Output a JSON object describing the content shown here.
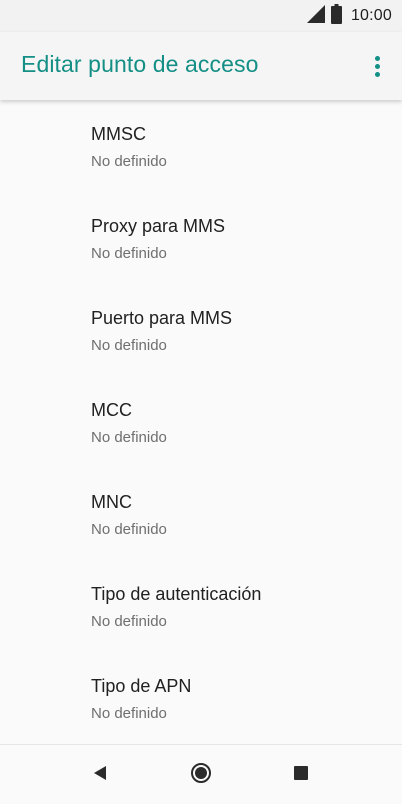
{
  "status_bar": {
    "time": "10:00",
    "icons": [
      "signal-icon",
      "battery-icon"
    ]
  },
  "app_bar": {
    "title": "Editar punto de acceso",
    "accent_color": "#148f85",
    "menu_icon": "more-vert-icon"
  },
  "settings": {
    "items": [
      {
        "title": "MMSC",
        "summary": "No definido"
      },
      {
        "title": "Proxy para MMS",
        "summary": "No definido"
      },
      {
        "title": "Puerto para MMS",
        "summary": "No definido"
      },
      {
        "title": "MCC",
        "summary": "No definido"
      },
      {
        "title": "MNC",
        "summary": "No definido"
      },
      {
        "title": "Tipo de autenticación",
        "summary": "No definido"
      },
      {
        "title": "Tipo de APN",
        "summary": "No definido"
      }
    ]
  },
  "nav_bar": {
    "icons": [
      "back-icon",
      "home-icon",
      "recents-icon"
    ]
  }
}
